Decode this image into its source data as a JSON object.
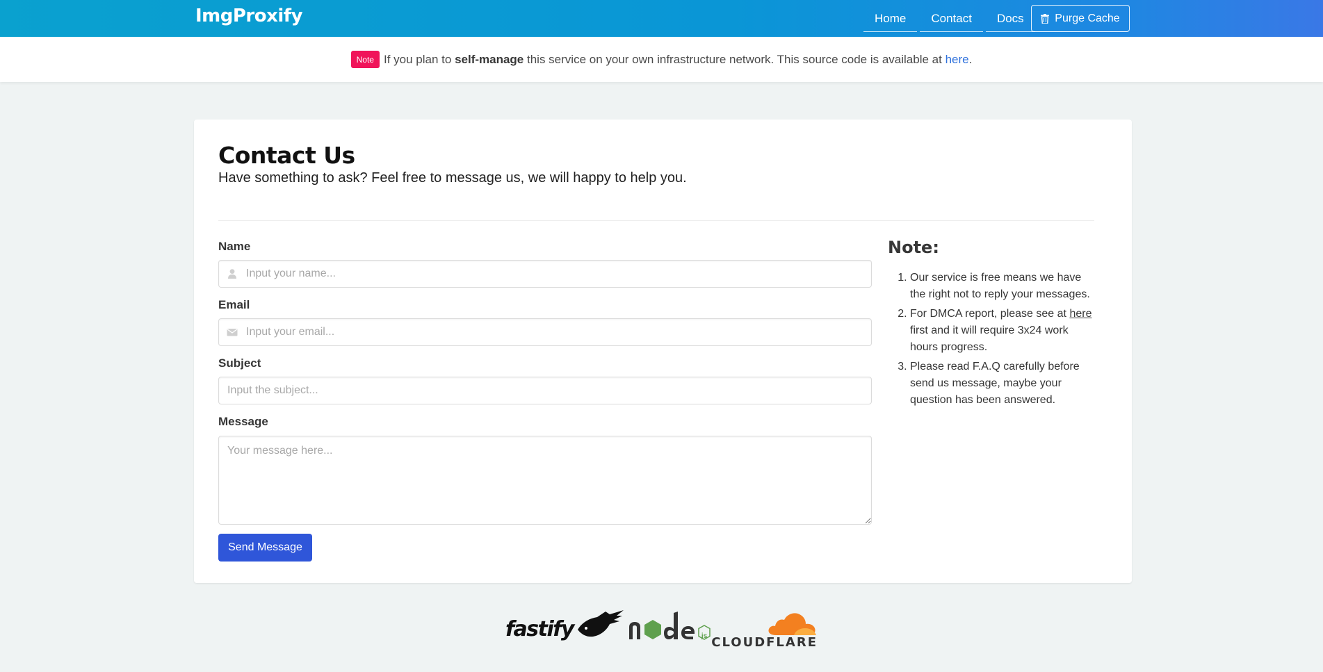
{
  "navbar": {
    "brand": "ImgProxify",
    "links": [
      {
        "label": "Home"
      },
      {
        "label": "Contact"
      },
      {
        "label": "Docs"
      }
    ],
    "purge_label": "Purge Cache",
    "purge_icon": "trash-icon"
  },
  "notice": {
    "tag": "Note",
    "text_before": "If you plan to",
    "bold": "self-manage",
    "text_after": "this service on your own infrastructure network. This source code is available at",
    "link": "here",
    "end": "."
  },
  "contact": {
    "title": "Contact Us",
    "subtitle": "Have something to ask? Feel free to message us, we will happy to help you.",
    "fields": {
      "name_label": "Name",
      "name_placeholder": "Input your name...",
      "email_label": "Email",
      "email_placeholder": "Input your email...",
      "subject_label": "Subject",
      "subject_placeholder": "Input the subject...",
      "message_label": "Message",
      "message_placeholder": "Your message here..."
    },
    "send_label": "Send Message"
  },
  "note": {
    "title": "Note:",
    "items": [
      {
        "text": "Our service is free means we have the right not to reply your messages."
      },
      {
        "before": "For DMCA report, please see at",
        "link": "here",
        "after": "first and it will require 3x24 work hours progress."
      },
      {
        "text": "Please read F.A.Q carefully before send us message, maybe your question has been answered."
      }
    ]
  },
  "footer": {
    "logos": [
      "fastify",
      "node",
      "js",
      "CLOUDFLARE"
    ],
    "colors": {
      "node_green": "#5fa04e",
      "cloudflare_orange": "#f38020"
    }
  },
  "colors": {
    "nav_gradient_start": "#0aa1cf",
    "nav_gradient_end": "#3a78e6",
    "tag": "#f0145a",
    "link": "#3273dc",
    "primary_button": "#2f56d9"
  }
}
